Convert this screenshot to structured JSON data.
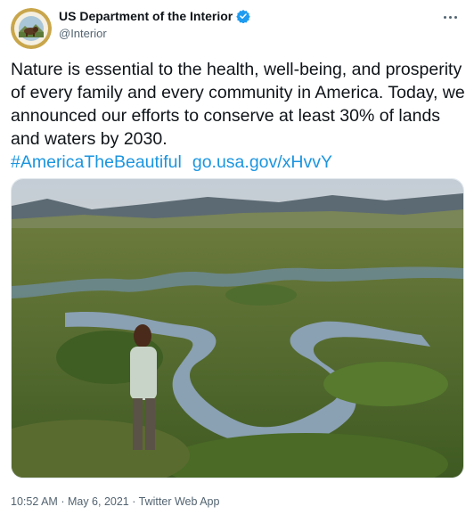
{
  "account": {
    "name": "US Department of the Interior",
    "handle": "@Interior",
    "verified": true
  },
  "tweet": {
    "text": "Nature is essential to the health, well-being, and prosperity of every family and every community in America. Today, we announced our efforts to conserve at least 30% of lands and waters by 2030.",
    "hashtag": "#AmericaTheBeautiful",
    "link": "go.usa.gov/xHvvY"
  },
  "media": {
    "subject": "river-valley-landscape-with-hiker-photo"
  },
  "footer": {
    "time": "10:52 AM",
    "separator": "·",
    "date": "May 6, 2021",
    "source": "Twitter Web App"
  },
  "colors": {
    "link": "#1b95e0",
    "verified": "#1d9bf0",
    "text": "#0f1419",
    "muted": "#536471"
  }
}
